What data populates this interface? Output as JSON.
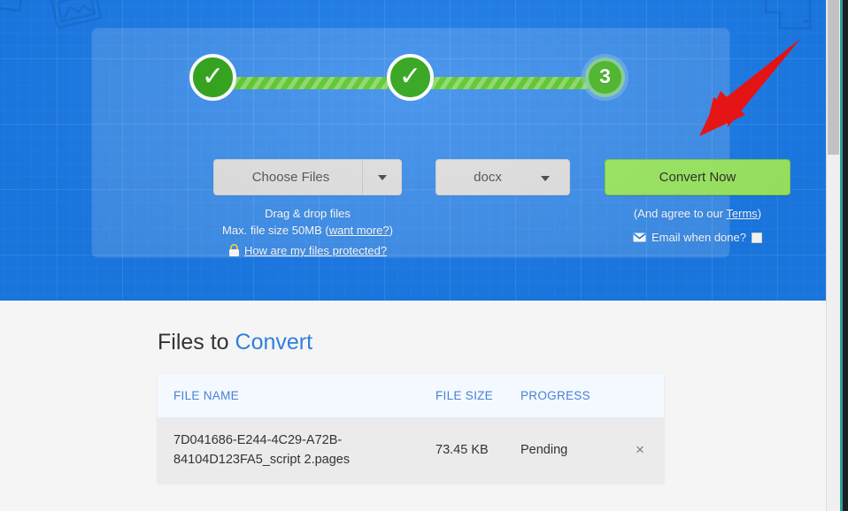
{
  "hero": {
    "background_color": "#1a7ae8",
    "panel_overlay": "rgba(255,255,255,0.16)"
  },
  "stepper": {
    "steps": [
      {
        "id": "step-1",
        "state": "complete",
        "glyph": "✓"
      },
      {
        "id": "step-2",
        "state": "complete",
        "glyph": "✓"
      },
      {
        "id": "step-3",
        "state": "current",
        "glyph": "3"
      }
    ],
    "complete_color": "#2fa318",
    "track_color": "#5cc72c"
  },
  "controls": {
    "choose_files_label": "Choose Files",
    "choose_files_caret": "chevron-down-icon",
    "format_value": "docx",
    "format_caret": "chevron-down-icon",
    "convert_label": "Convert Now",
    "convert_color": "#9ce862"
  },
  "helper": {
    "drag_drop": "Drag & drop files",
    "max_size_prefix": "Max. file size 50MB ",
    "want_more_open": "(",
    "want_more_link": "want more?",
    "want_more_close": ")",
    "protected_link": "How are my files protected?",
    "lock_icon": "lock-icon",
    "terms_prefix": "(And agree to our ",
    "terms_link": "Terms",
    "terms_suffix": ")",
    "email_icon": "envelope-icon",
    "email_label": "Email when done?",
    "email_checked": false
  },
  "files_section": {
    "title_plain": "Files to ",
    "title_accent": "Convert",
    "columns": [
      "FILE NAME",
      "FILE SIZE",
      "PROGRESS",
      ""
    ],
    "rows": [
      {
        "name": "7D041686-E244-4C29-A72B-84104D123FA5_script 2.pages",
        "size": "73.45 KB",
        "progress": "Pending",
        "remove": "×"
      }
    ]
  },
  "annotation": {
    "arrow_color": "#ee1111",
    "arrow_points_to": "convert-now-button"
  },
  "scrollbar": {
    "thumb_color": "#c2c2c2",
    "track_color": "#f0f0f0"
  }
}
